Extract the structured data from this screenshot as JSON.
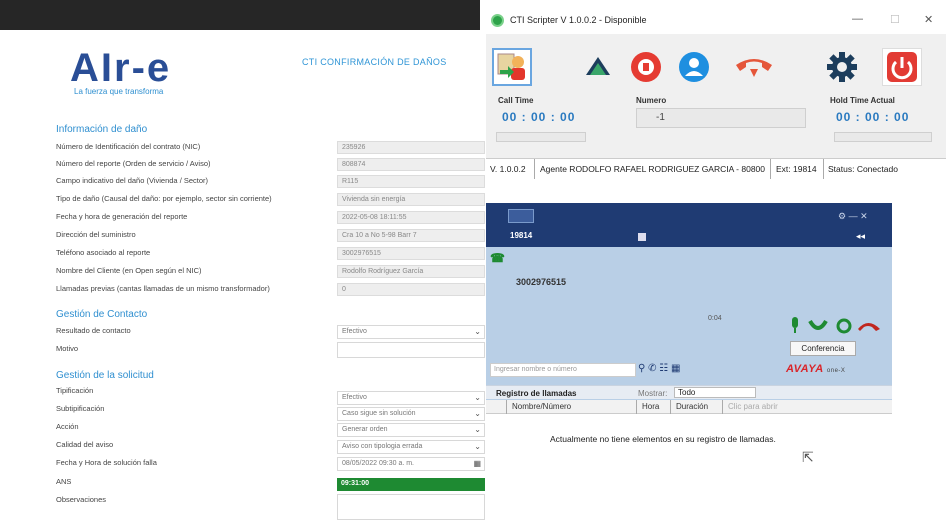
{
  "form": {
    "logo_text": "AIr-e",
    "logo_tagline": "La fuerza que transforma",
    "title": "CTI CONFIRMACIÓN DE DAÑOS",
    "section_damage": "Información de daño",
    "fields": [
      {
        "label": "Número de Identificación del contrato (NIC)",
        "value": "235926"
      },
      {
        "label": "Número del reporte (Orden de servicio / Aviso)",
        "value": "808874"
      },
      {
        "label": "Campo indicativo del daño (Vivienda / Sector)",
        "value": "R115"
      },
      {
        "label": "Tipo de daño (Causal del daño: por ejemplo, sector sin corriente)",
        "value": "Vivienda sin energía"
      },
      {
        "label": "Fecha y hora de generación del reporte",
        "value": "2022-05-08 18:11:55"
      },
      {
        "label": "Dirección del suministro",
        "value": "Cra 10 a No 5-98 Barr 7"
      },
      {
        "label": "Teléfono asociado al reporte",
        "value": "3002976515"
      },
      {
        "label": "Nombre del Cliente (en Open según el NIC)",
        "value": "Rodolfo Rodríguez García"
      },
      {
        "label": "Llamadas previas (cantas llamadas de un mismo transformador)",
        "value": "0"
      }
    ],
    "section_contact": "Gestión de Contacto",
    "contact_fields": [
      {
        "label": "Resultado de contacto",
        "value": "Efectivo"
      },
      {
        "label": "Motivo",
        "value": ""
      }
    ],
    "section_request": "Gestión de la solicitud",
    "request_fields": [
      {
        "label": "Tipificación",
        "value": "Efectivo"
      },
      {
        "label": "Subtipificación",
        "value": "Caso sigue sin solución"
      },
      {
        "label": "Acción",
        "value": "Generar orden"
      },
      {
        "label": "Calidad del aviso",
        "value": "Aviso con tipologia errada"
      },
      {
        "label": "Fecha y Hora de solución falla",
        "value": "08/05/2022 09:30 a. m."
      },
      {
        "label": "ANS",
        "value": "09:31:00"
      },
      {
        "label": "Observaciones",
        "value": ""
      }
    ]
  },
  "cti": {
    "title": "CTI Scripter V 1.0.0.2 - Disponible",
    "call_time_label": "Call Time",
    "call_time_value": "00 : 00 : 00",
    "numero_label": "Numero",
    "numero_value": "-1",
    "hold_time_label": "Hold Time Actual",
    "hold_time_value": "00 : 00 : 00",
    "status_version": "V. 1.0.0.2",
    "status_agent": "Agente RODOLFO RAFAEL RODRIGUEZ GARCIA - 80800",
    "status_ext": "Ext: 19814",
    "status_state": "Status: Conectado"
  },
  "phone": {
    "extension": "19814",
    "dialed_number": "3002976515",
    "duration": "0:04",
    "conference_button": "Conferencia",
    "search_placeholder": "Ingresar nombre o número",
    "brand": "AVAYA",
    "brand_sub": "one-X",
    "call_log_title": "Registro de llamadas",
    "filter_label": "Mostrar:",
    "filter_value": "Todo",
    "columns": [
      "Nombre/Número",
      "Hora",
      "Duración",
      "Clic para abrir"
    ],
    "empty_message": "Actualmente no tiene elementos en su registro de llamadas."
  },
  "colors": {
    "brand_blue": "#2a4e96",
    "accent": "#2f95d6",
    "green": "#1e8a32",
    "avaya_red": "#d9252a"
  }
}
